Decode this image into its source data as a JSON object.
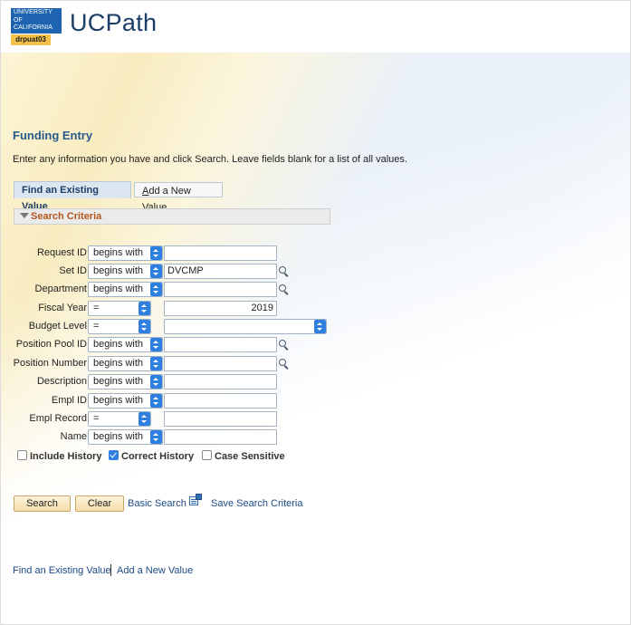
{
  "header": {
    "logo_lines": [
      "UNIVERSITY",
      "OF",
      "CALIFORNIA"
    ],
    "environment": "drpuat03",
    "app_title": "UCPath"
  },
  "page": {
    "title": "Funding Entry",
    "instructions": "Enter any information you have and click Search. Leave fields blank for a list of all values."
  },
  "tabs": {
    "active": "Find an Existing Value",
    "inactive_underlined": "A",
    "inactive_rest": "dd a New Value"
  },
  "section": {
    "label": "Search Criteria"
  },
  "fields": [
    {
      "label": "Request ID",
      "operator": "begins with",
      "value": "",
      "lookup": false
    },
    {
      "label": "Set ID",
      "operator": "begins with",
      "value": "DVCMP",
      "lookup": true
    },
    {
      "label": "Department",
      "operator": "begins with",
      "value": "",
      "lookup": true
    },
    {
      "label": "Fiscal Year",
      "operator": "=",
      "value": "2019",
      "lookup": false
    },
    {
      "label": "Budget Level",
      "operator": "=",
      "value": "",
      "lookup": false
    },
    {
      "label": "Position Pool ID",
      "operator": "begins with",
      "value": "",
      "lookup": true
    },
    {
      "label": "Position Number",
      "operator": "begins with",
      "value": "",
      "lookup": true
    },
    {
      "label": "Description",
      "operator": "begins with",
      "value": "",
      "lookup": false
    },
    {
      "label": "Empl ID",
      "operator": "begins with",
      "value": "",
      "lookup": false
    },
    {
      "label": "Empl Record",
      "operator": "=",
      "value": "",
      "lookup": false
    },
    {
      "label": "Name",
      "operator": "begins with",
      "value": "",
      "lookup": false
    }
  ],
  "checkboxes": [
    {
      "label": "Include History",
      "checked": false
    },
    {
      "label": "Correct History",
      "checked": true
    },
    {
      "label": "Case Sensitive",
      "checked": false
    }
  ],
  "actions": {
    "search": "Search",
    "clear": "Clear",
    "basic_search": "Basic Search",
    "save_search": "Save Search Criteria"
  },
  "footer": {
    "find_existing": "Find an Existing Value",
    "add_new": "Add a New Value"
  },
  "colors": {
    "title_blue": "#285a8c",
    "section_orange": "#b5561e",
    "link_blue": "#1b4a87",
    "dropdown_blue": "#2f7fe0"
  },
  "icons": {
    "lookup": "magnifier-icon",
    "save_search": "save-search-icon",
    "collapse": "triangle-down-icon"
  }
}
